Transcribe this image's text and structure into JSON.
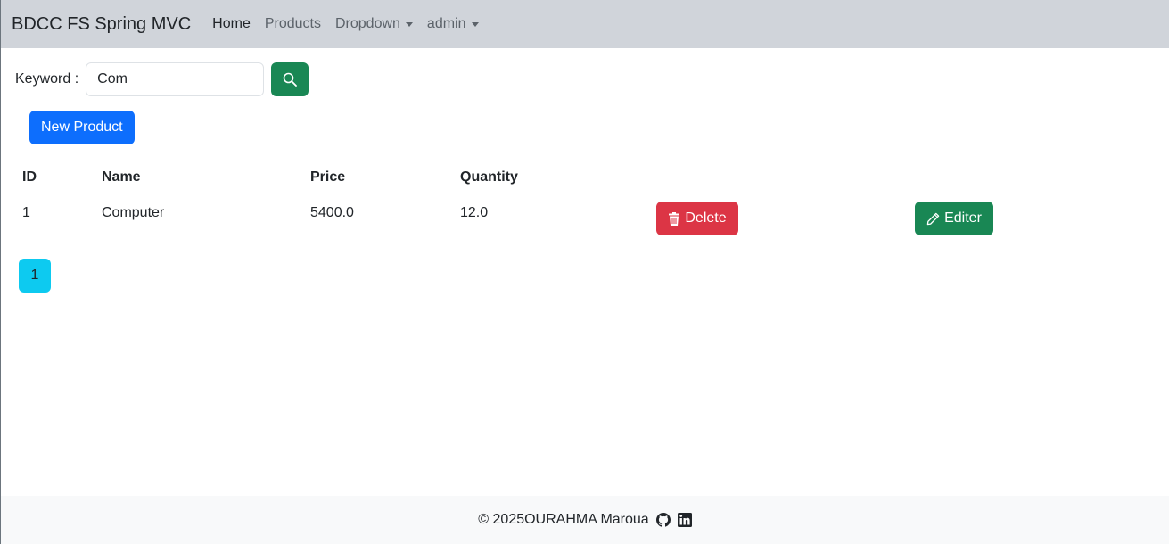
{
  "navbar": {
    "brand": "BDCC FS Spring MVC",
    "links": [
      {
        "label": "Home",
        "active": true
      },
      {
        "label": "Products",
        "active": false
      },
      {
        "label": "Dropdown",
        "active": false,
        "dropdown": true
      },
      {
        "label": "admin",
        "active": false,
        "dropdown": true
      }
    ]
  },
  "search": {
    "label": "Keyword :",
    "value": "Com",
    "button_icon": "search-icon"
  },
  "actions": {
    "new_product_label": "New Product"
  },
  "table": {
    "headers": [
      "ID",
      "Name",
      "Price",
      "Quantity"
    ],
    "rows": [
      {
        "id": "1",
        "name": "Computer",
        "price": "5400.0",
        "quantity": "12.0",
        "delete_label": "Delete",
        "edit_label": "Editer"
      }
    ]
  },
  "pagination": {
    "pages": [
      "1"
    ]
  },
  "footer": {
    "text": "© 2025OURAHMA Maroua",
    "icons": [
      "github-icon",
      "linkedin-icon"
    ]
  },
  "colors": {
    "navbar_bg": "#d0d4da",
    "primary": "#0d6efd",
    "success": "#198754",
    "danger": "#dc3545",
    "info": "#0dcaf0"
  }
}
